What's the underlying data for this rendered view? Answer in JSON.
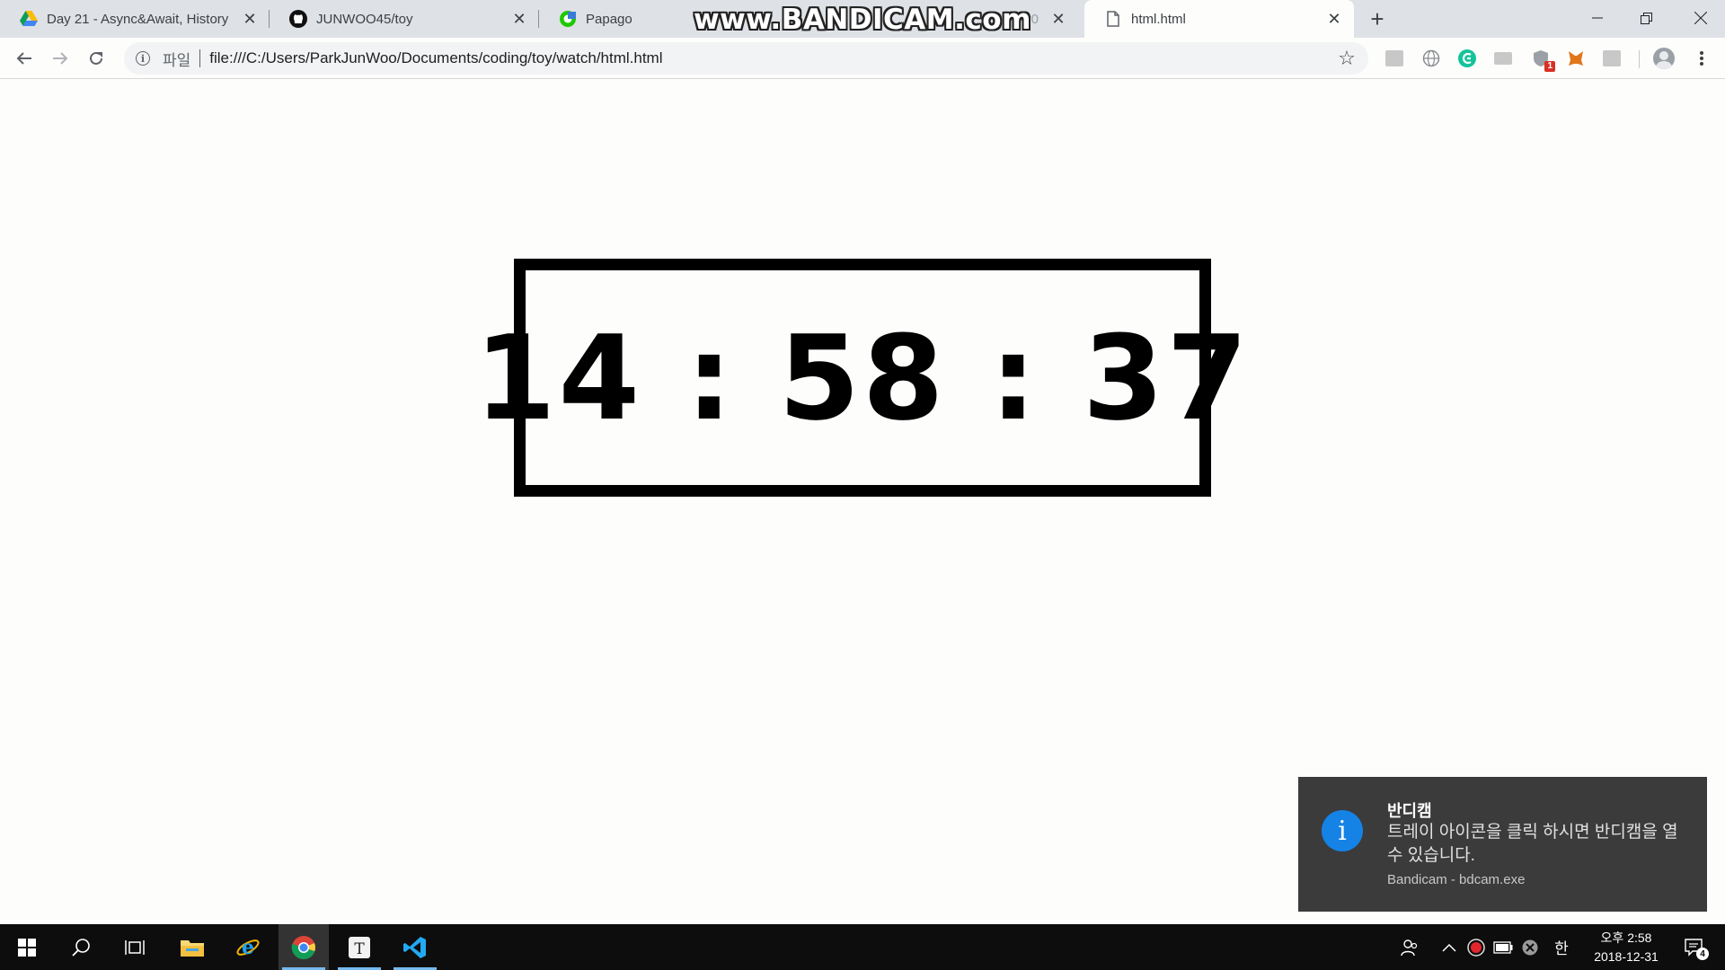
{
  "browser": {
    "tabs": [
      {
        "title": "Day 21 - Async&Await, History",
        "favicon": "google-drive-icon"
      },
      {
        "title": "JUNWOO45/toy",
        "favicon": "github-icon"
      },
      {
        "title": "Papago",
        "favicon": "papago-icon"
      },
      {
        "title": "r0",
        "favicon": "document-icon"
      },
      {
        "title": "html.html",
        "favicon": "file-icon",
        "active": true
      }
    ],
    "watermark": "www.BANDICAM.com",
    "address": {
      "scheme_label": "파일",
      "url": "file:///C:/Users/ParkJunWoo/Documents/coding/toy/watch/html.html"
    },
    "extension_badge": "1"
  },
  "page": {
    "clock": "14 : 58 : 37"
  },
  "toast": {
    "title": "반디캠",
    "body": "트레이 아이콘을 클릭 하시면 반디캠을 열 수 있습니다.",
    "source": "Bandicam - bdcam.exe"
  },
  "taskbar": {
    "ime": "한",
    "time": "오후 2:58",
    "date": "2018-12-31",
    "notification_count": "4"
  },
  "colors": {
    "toast_icon": "#1583e6",
    "taskbar": "#0d0d0d",
    "tabstrip": "#dee1e6"
  }
}
